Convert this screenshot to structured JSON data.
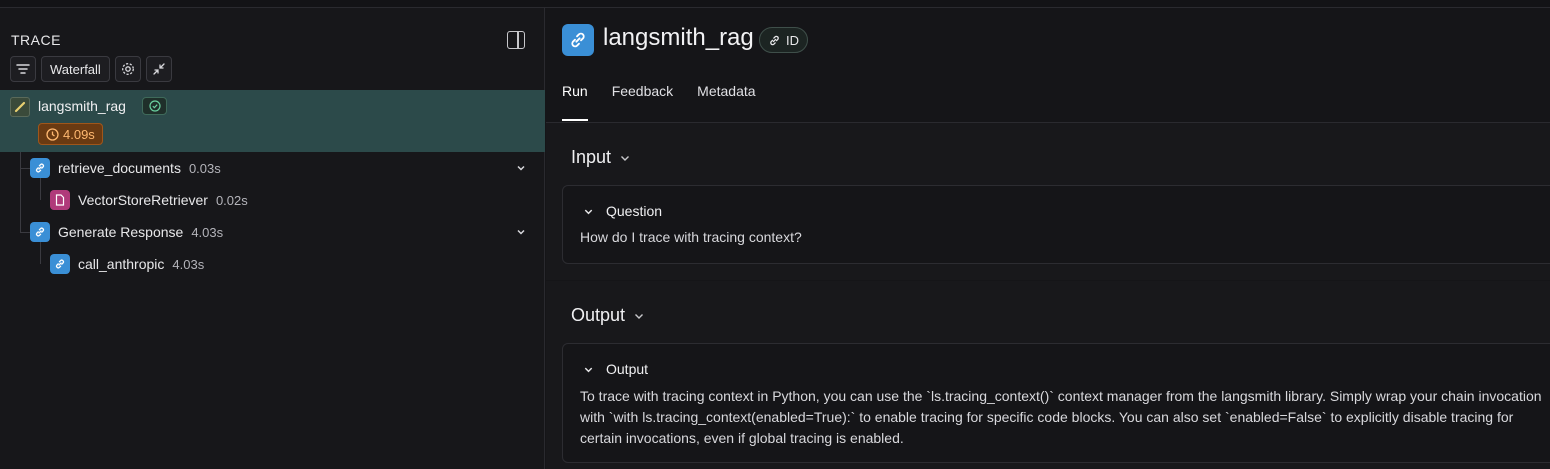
{
  "left_panel": {
    "title": "TRACE",
    "view_mode": "Waterfall",
    "root": {
      "name": "langsmith_rag",
      "latency": "4.09s"
    },
    "nodes": [
      {
        "name": "retrieve_documents",
        "latency": "0.03s",
        "icon": "link-icon"
      },
      {
        "name": "VectorStoreRetriever",
        "latency": "0.02s",
        "icon": "document-icon"
      },
      {
        "name": "Generate Response",
        "latency": "4.03s",
        "icon": "link-icon"
      },
      {
        "name": "call_anthropic",
        "latency": "4.03s",
        "icon": "link-icon"
      }
    ]
  },
  "run": {
    "title": "langsmith_rag",
    "id_label": "ID",
    "tabs": [
      "Run",
      "Feedback",
      "Metadata"
    ],
    "input": {
      "heading": "Input",
      "field_label": "Question",
      "value": "How do I trace with tracing context?"
    },
    "output": {
      "heading": "Output",
      "field_label": "Output",
      "value": "To trace with tracing context in Python, you can use the `ls.tracing_context()` context manager from the langsmith library. Simply wrap your chain invocation with `with ls.tracing_context(enabled=True):` to enable tracing for specific code blocks. You can also set `enabled=False` to explicitly disable tracing for certain invocations, even if global tracing is enabled."
    }
  },
  "colors": {
    "accent_blue": "#3a8fd6",
    "selected_row": "#2c4a4a",
    "latency_warning": "#ffb870",
    "llm_pink": "#b03a7a"
  }
}
